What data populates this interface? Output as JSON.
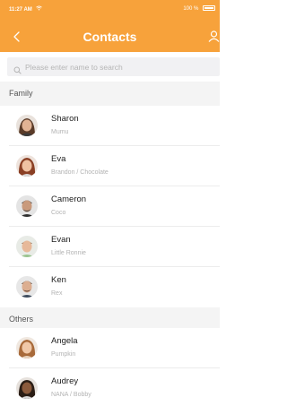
{
  "status_bar": {
    "time": "11:27 AM",
    "battery": "100 %"
  },
  "nav": {
    "title": "Contacts"
  },
  "search": {
    "placeholder": "Please enter name to search"
  },
  "sections": {
    "family": {
      "label": "Family",
      "items": [
        {
          "name": "Sharon",
          "nickname": "Mumu"
        },
        {
          "name": "Eva",
          "nickname": "Brandon / Chocolate"
        },
        {
          "name": "Cameron",
          "nickname": "Coco"
        },
        {
          "name": "Evan",
          "nickname": "Little Ronnie"
        },
        {
          "name": "Ken",
          "nickname": "Rex"
        }
      ]
    },
    "others": {
      "label": "Others",
      "items": [
        {
          "name": "Angela",
          "nickname": "Pumpkin"
        },
        {
          "name": "Audrey",
          "nickname": "NANA / Bobby"
        }
      ]
    }
  },
  "colors": {
    "accent": "#f7a23b",
    "section_bg": "#f4f4f4",
    "subtext": "#b3b3b3"
  },
  "icons": {
    "back": "chevron-left-icon",
    "profile": "user-icon",
    "search": "search-icon",
    "wifi": "wifi-icon",
    "battery": "battery-icon"
  }
}
